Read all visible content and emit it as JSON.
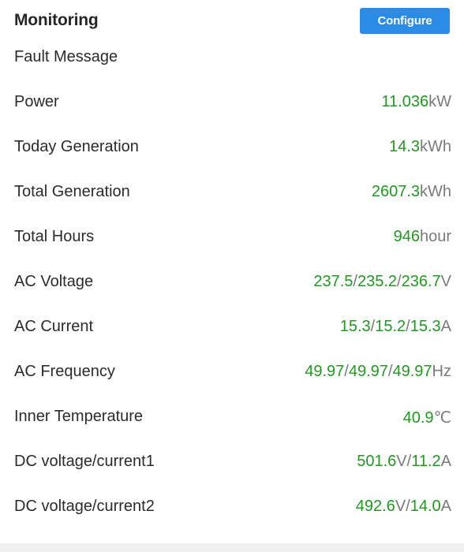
{
  "header": {
    "title": "Monitoring",
    "configure_label": "Configure"
  },
  "fault_message_label": "Fault Message",
  "colors": {
    "value": "#1f9a1f",
    "unit": "#7a7a7a",
    "button": "#2b8ce8"
  },
  "rows": [
    {
      "label": "Power",
      "parts": [
        {
          "t": "11.036",
          "k": "num"
        },
        {
          "t": "kW",
          "k": "unit"
        }
      ]
    },
    {
      "label": "Today Generation",
      "parts": [
        {
          "t": "14.3",
          "k": "num"
        },
        {
          "t": "kWh",
          "k": "unit"
        }
      ]
    },
    {
      "label": "Total Generation",
      "parts": [
        {
          "t": "2607.3",
          "k": "num"
        },
        {
          "t": "kWh",
          "k": "unit"
        }
      ]
    },
    {
      "label": "Total Hours",
      "parts": [
        {
          "t": "946",
          "k": "num"
        },
        {
          "t": "hour",
          "k": "unit"
        }
      ]
    },
    {
      "label": "AC Voltage",
      "parts": [
        {
          "t": "237.5",
          "k": "num"
        },
        {
          "t": "/",
          "k": "unit"
        },
        {
          "t": "235.2",
          "k": "num"
        },
        {
          "t": "/",
          "k": "unit"
        },
        {
          "t": "236.7",
          "k": "num"
        },
        {
          "t": "V",
          "k": "unit"
        }
      ]
    },
    {
      "label": "AC Current",
      "parts": [
        {
          "t": "15.3",
          "k": "num"
        },
        {
          "t": "/",
          "k": "unit"
        },
        {
          "t": "15.2",
          "k": "num"
        },
        {
          "t": "/",
          "k": "unit"
        },
        {
          "t": "15.3",
          "k": "num"
        },
        {
          "t": "A",
          "k": "unit"
        }
      ]
    },
    {
      "label": "AC Frequency",
      "parts": [
        {
          "t": "49.97",
          "k": "num"
        },
        {
          "t": "/",
          "k": "unit"
        },
        {
          "t": "49.97",
          "k": "num"
        },
        {
          "t": "/",
          "k": "unit"
        },
        {
          "t": "49.97",
          "k": "num"
        },
        {
          "t": "Hz",
          "k": "unit"
        }
      ]
    },
    {
      "label": "Inner Temperature",
      "parts": [
        {
          "t": "40.9",
          "k": "num"
        },
        {
          "t": "℃",
          "k": "unit"
        }
      ]
    },
    {
      "label": "DC voltage/current1",
      "parts": [
        {
          "t": "501.6",
          "k": "num"
        },
        {
          "t": "V/",
          "k": "unit"
        },
        {
          "t": "11.2",
          "k": "num"
        },
        {
          "t": "A",
          "k": "unit"
        }
      ]
    },
    {
      "label": "DC voltage/current2",
      "parts": [
        {
          "t": "492.6",
          "k": "num"
        },
        {
          "t": "V/",
          "k": "unit"
        },
        {
          "t": "14.0",
          "k": "num"
        },
        {
          "t": "A",
          "k": "unit"
        }
      ]
    }
  ]
}
